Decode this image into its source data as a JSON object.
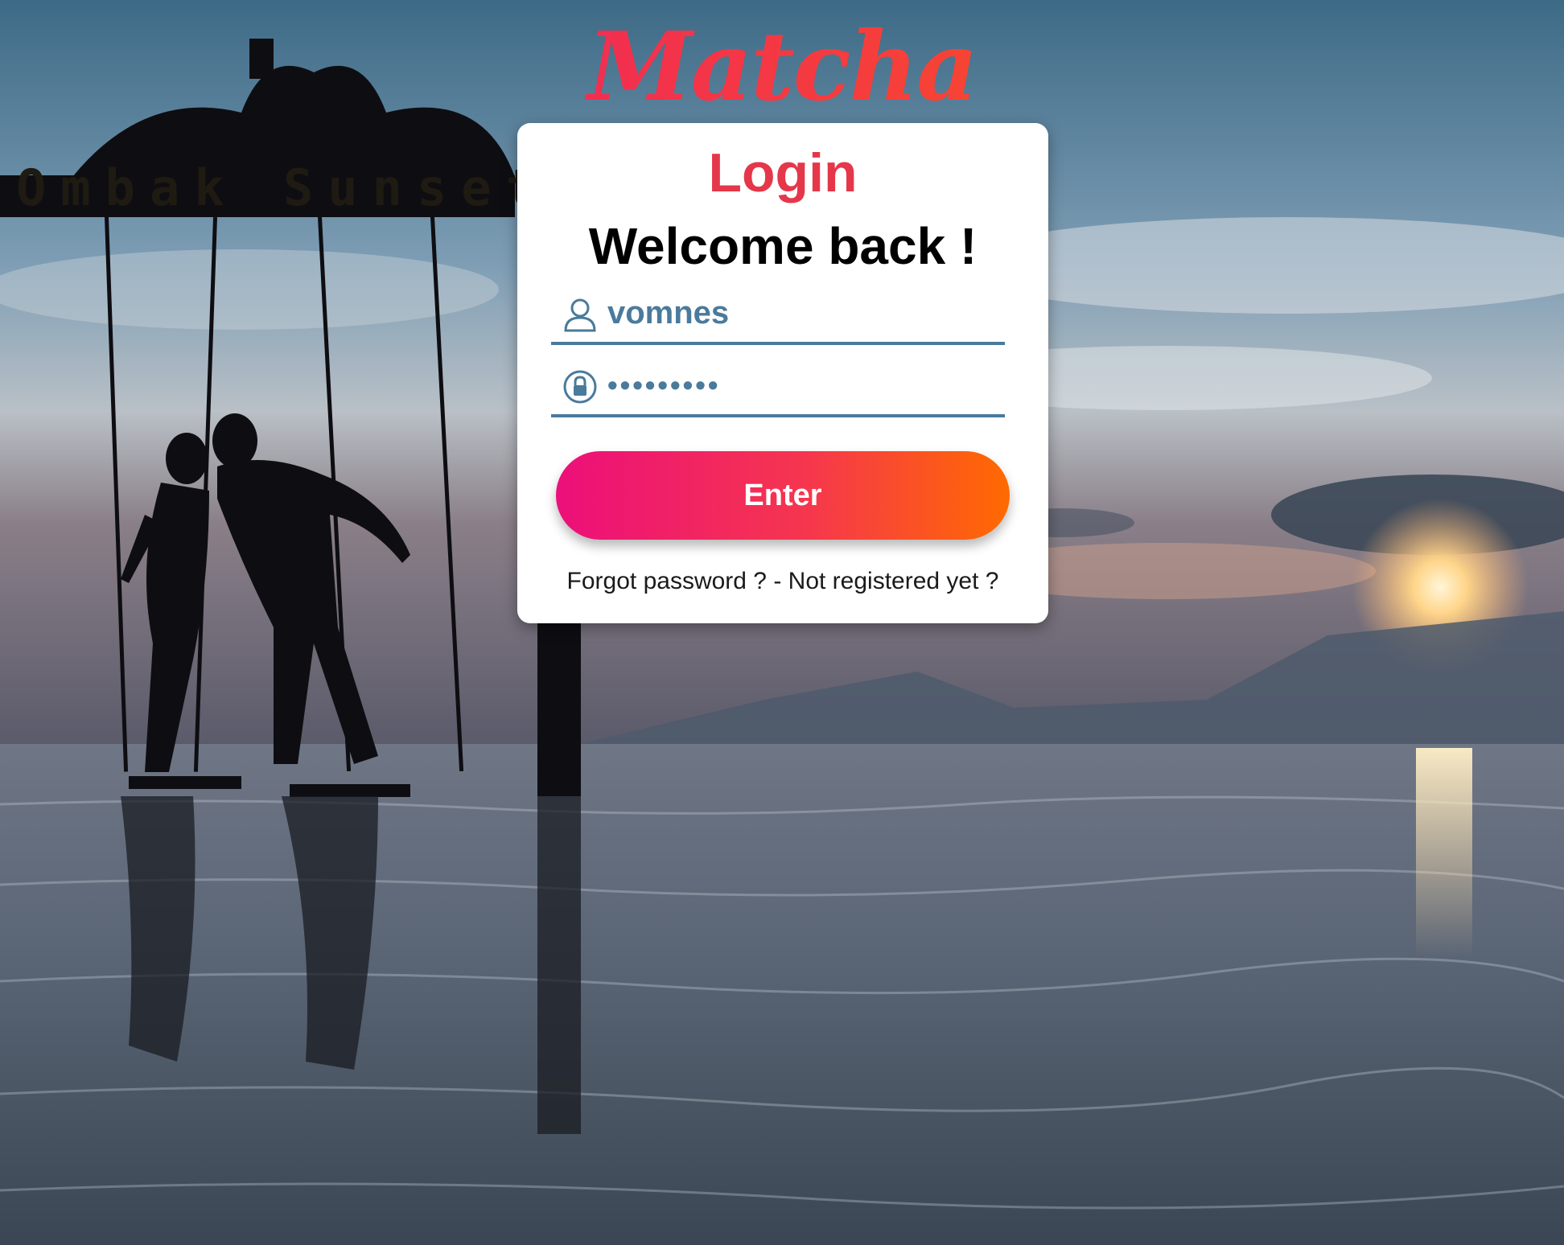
{
  "app": {
    "logo_text": "Matcha"
  },
  "login_card": {
    "title": "Login",
    "subtitle": "Welcome back !",
    "username": {
      "icon": "user-icon",
      "value": "vomnes"
    },
    "password": {
      "icon": "lock-icon",
      "value": "•••••••••"
    },
    "enter_button_label": "Enter",
    "forgot_password_link": "Forgot password ?",
    "separator": " - ",
    "register_link": "Not registered yet ?"
  },
  "background": {
    "sign_text": "Ombak Sunset"
  },
  "colors": {
    "accent_pink": "#ec0f7a",
    "accent_red": "#e5374a",
    "accent_orange": "#ff6a00",
    "field_blue": "#4a7a9c"
  }
}
